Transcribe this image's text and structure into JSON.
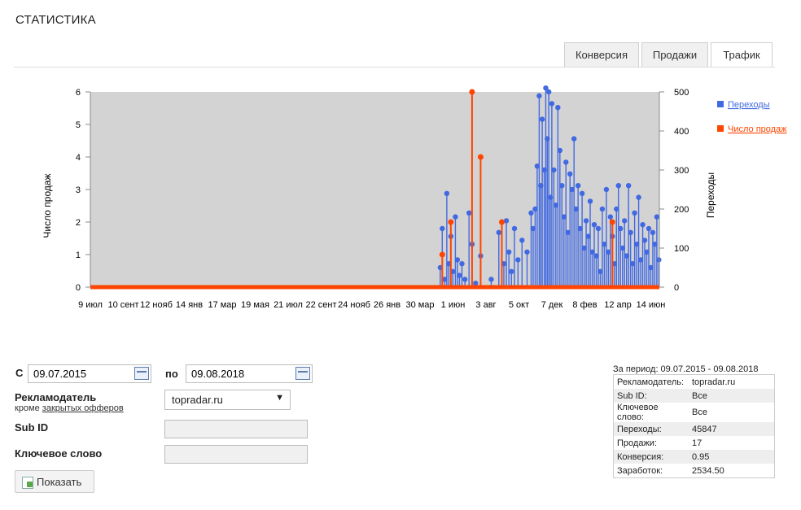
{
  "page": {
    "title": "СТАТИСТИКА"
  },
  "tabs": [
    {
      "label": "Конверсия",
      "active": false
    },
    {
      "label": "Продажи",
      "active": false
    },
    {
      "label": "Трафик",
      "active": true
    }
  ],
  "chart_data": {
    "type": "line",
    "background": "#d3d3d3",
    "ylabel_left": "Число продаж",
    "ylabel_right": "Переходы",
    "ylim_left": [
      0,
      6
    ],
    "ylim_right": [
      0,
      500
    ],
    "left_ticks": [
      "0",
      "1",
      "2",
      "3",
      "4",
      "5",
      "6"
    ],
    "right_ticks": [
      "0",
      "100",
      "200",
      "300",
      "400",
      "500"
    ],
    "x_tick_labels": [
      "9 июл",
      "10 сент",
      "12 нояб",
      "14 янв",
      "17 мар",
      "19 мая",
      "21 июл",
      "22 сент",
      "24 нояб",
      "26 янв",
      "30 мар",
      "1 июн",
      "3 авг",
      "5 окт",
      "7 дек",
      "8 фев",
      "12 апр",
      "14 июн"
    ],
    "x_range": [
      "2015-07-09",
      "2018-08-09"
    ],
    "series": [
      {
        "name": "Переходы",
        "color": "#4169e1",
        "axis": "right",
        "note": "daily values, 0 before Jun 2017",
        "points": [
          [
            "2017-06-01",
            50
          ],
          [
            "2017-06-05",
            150
          ],
          [
            "2017-06-10",
            20
          ],
          [
            "2017-06-14",
            240
          ],
          [
            "2017-06-18",
            60
          ],
          [
            "2017-06-22",
            130
          ],
          [
            "2017-06-26",
            40
          ],
          [
            "2017-07-01",
            180
          ],
          [
            "2017-07-05",
            70
          ],
          [
            "2017-07-09",
            30
          ],
          [
            "2017-07-14",
            60
          ],
          [
            "2017-07-20",
            20
          ],
          [
            "2017-07-28",
            190
          ],
          [
            "2017-08-03",
            110
          ],
          [
            "2017-08-10",
            10
          ],
          [
            "2017-08-20",
            80
          ],
          [
            "2017-09-10",
            20
          ],
          [
            "2017-09-25",
            140
          ],
          [
            "2017-10-05",
            60
          ],
          [
            "2017-10-10",
            170
          ],
          [
            "2017-10-15",
            90
          ],
          [
            "2017-10-20",
            40
          ],
          [
            "2017-10-26",
            150
          ],
          [
            "2017-11-02",
            70
          ],
          [
            "2017-11-10",
            120
          ],
          [
            "2017-11-20",
            90
          ],
          [
            "2017-11-28",
            190
          ],
          [
            "2017-12-02",
            150
          ],
          [
            "2017-12-06",
            200
          ],
          [
            "2017-12-10",
            310
          ],
          [
            "2017-12-14",
            490
          ],
          [
            "2017-12-17",
            260
          ],
          [
            "2017-12-20",
            430
          ],
          [
            "2017-12-24",
            300
          ],
          [
            "2017-12-27",
            510
          ],
          [
            "2017-12-30",
            380
          ],
          [
            "2018-01-02",
            500
          ],
          [
            "2018-01-05",
            230
          ],
          [
            "2018-01-08",
            470
          ],
          [
            "2018-01-12",
            300
          ],
          [
            "2018-01-16",
            210
          ],
          [
            "2018-01-20",
            460
          ],
          [
            "2018-01-24",
            350
          ],
          [
            "2018-01-28",
            260
          ],
          [
            "2018-02-01",
            180
          ],
          [
            "2018-02-05",
            320
          ],
          [
            "2018-02-09",
            140
          ],
          [
            "2018-02-13",
            290
          ],
          [
            "2018-02-17",
            250
          ],
          [
            "2018-02-21",
            380
          ],
          [
            "2018-02-25",
            200
          ],
          [
            "2018-03-01",
            260
          ],
          [
            "2018-03-05",
            150
          ],
          [
            "2018-03-09",
            240
          ],
          [
            "2018-03-13",
            100
          ],
          [
            "2018-03-17",
            170
          ],
          [
            "2018-03-21",
            130
          ],
          [
            "2018-03-25",
            220
          ],
          [
            "2018-03-29",
            90
          ],
          [
            "2018-04-02",
            160
          ],
          [
            "2018-04-06",
            80
          ],
          [
            "2018-04-10",
            150
          ],
          [
            "2018-04-14",
            40
          ],
          [
            "2018-04-18",
            200
          ],
          [
            "2018-04-22",
            110
          ],
          [
            "2018-04-26",
            250
          ],
          [
            "2018-04-30",
            90
          ],
          [
            "2018-05-04",
            180
          ],
          [
            "2018-05-08",
            130
          ],
          [
            "2018-05-12",
            60
          ],
          [
            "2018-05-16",
            200
          ],
          [
            "2018-05-20",
            260
          ],
          [
            "2018-05-24",
            150
          ],
          [
            "2018-05-28",
            100
          ],
          [
            "2018-06-01",
            170
          ],
          [
            "2018-06-05",
            80
          ],
          [
            "2018-06-09",
            260
          ],
          [
            "2018-06-13",
            140
          ],
          [
            "2018-06-17",
            60
          ],
          [
            "2018-06-21",
            190
          ],
          [
            "2018-06-25",
            110
          ],
          [
            "2018-06-29",
            230
          ],
          [
            "2018-07-03",
            70
          ],
          [
            "2018-07-07",
            160
          ],
          [
            "2018-07-11",
            120
          ],
          [
            "2018-07-15",
            90
          ],
          [
            "2018-07-19",
            150
          ],
          [
            "2018-07-23",
            50
          ],
          [
            "2018-07-27",
            140
          ],
          [
            "2018-07-31",
            110
          ],
          [
            "2018-08-04",
            180
          ],
          [
            "2018-08-08",
            70
          ]
        ]
      },
      {
        "name": "Число продаж",
        "color": "#ff4500",
        "axis": "left",
        "note": "mostly 0, spikes listed",
        "points": [
          [
            "2017-06-05",
            1
          ],
          [
            "2017-06-22",
            2
          ],
          [
            "2017-08-03",
            6
          ],
          [
            "2017-08-20",
            4
          ],
          [
            "2017-10-01",
            2
          ],
          [
            "2018-05-08",
            2
          ]
        ]
      }
    ]
  },
  "filters": {
    "from_label": "С",
    "from_value": "09.07.2015",
    "to_label": "по",
    "to_value": "09.08.2018",
    "advertiser_label": "Рекламодатель",
    "advertiser_except_prefix": "кроме",
    "advertiser_except_link": "закрытых офферов",
    "advertiser_value": "topradar.ru",
    "subid_label": "Sub ID",
    "subid_value": "",
    "keyword_label": "Ключевое слово",
    "keyword_value": "",
    "show_button": "Показать"
  },
  "summary": {
    "period": "За период: 09.07.2015 - 09.08.2018",
    "rows": [
      {
        "label": "Рекламодатель:",
        "value": "topradar.ru"
      },
      {
        "label": "Sub ID:",
        "value": "Все"
      },
      {
        "label": "Ключевое слово:",
        "value": "Все"
      },
      {
        "label": "Переходы:",
        "value": "45847"
      },
      {
        "label": "Продажи:",
        "value": "17"
      },
      {
        "label": "Конверсия:",
        "value": "0.95"
      },
      {
        "label": "Заработок:",
        "value": "2534.50"
      }
    ]
  }
}
